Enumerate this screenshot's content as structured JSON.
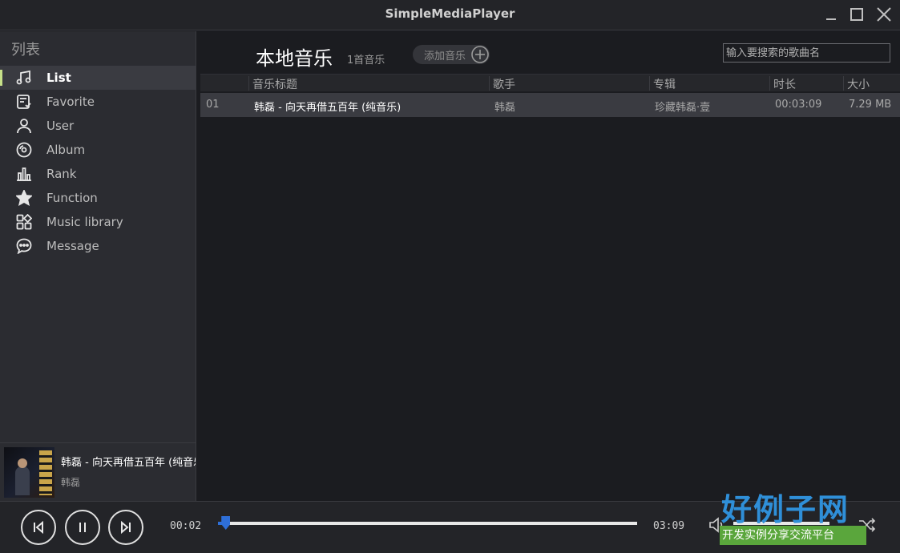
{
  "window": {
    "title": "SimpleMediaPlayer"
  },
  "sidebar": {
    "title": "列表",
    "items": [
      {
        "label": "List",
        "icon": "music-note-icon",
        "active": true
      },
      {
        "label": "Favorite",
        "icon": "heart-icon",
        "active": false
      },
      {
        "label": "User",
        "icon": "user-icon",
        "active": false
      },
      {
        "label": "Album",
        "icon": "disc-icon",
        "active": false
      },
      {
        "label": "Rank",
        "icon": "bar-chart-icon",
        "active": false
      },
      {
        "label": "Function",
        "icon": "star-icon",
        "active": false
      },
      {
        "label": "Music library",
        "icon": "grid-icon",
        "active": false
      },
      {
        "label": "Message",
        "icon": "chat-icon",
        "active": false
      }
    ]
  },
  "now_playing": {
    "title": "韩磊 - 向天再借五百年 (纯音乐)",
    "artist": "韩磊"
  },
  "main": {
    "title": "本地音乐",
    "count": "1首音乐",
    "add_label": "添加音乐",
    "search_placeholder": "输入要搜索的歌曲名",
    "columns": [
      "音乐标题",
      "歌手",
      "专辑",
      "时长",
      "大小"
    ],
    "rows": [
      {
        "index": "01",
        "title": "韩磊 - 向天再借五百年 (纯音乐)",
        "artist": "韩磊",
        "album": "珍藏韩磊·壹",
        "duration": "00:03:09",
        "size": "7.29 MB"
      }
    ]
  },
  "player": {
    "elapsed": "00:02",
    "total": "03:09",
    "progress_fraction": 0.01,
    "volume_fraction": 1.0,
    "accent_color": "#2e6fd8"
  },
  "watermark": {
    "logo": "好例子网",
    "tagline": "开发实例分享交流平台"
  }
}
